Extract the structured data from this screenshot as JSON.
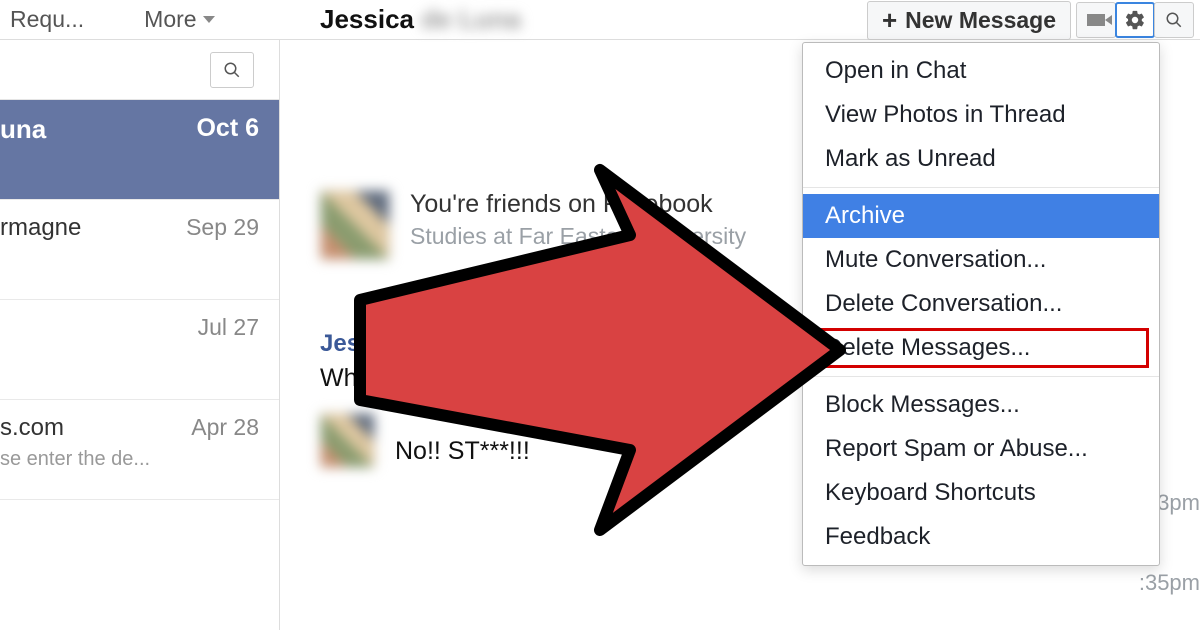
{
  "header": {
    "requests_label": "Requ...",
    "more_label": "More",
    "thread_name": "Jessica",
    "thread_name_blurred": "de Luna",
    "new_message_label": "New Message"
  },
  "sidebar": {
    "items": [
      {
        "name": "una",
        "date": "Oct 6",
        "preview": ""
      },
      {
        "name": "rmagne",
        "date": "Sep 29",
        "preview": ""
      },
      {
        "name": "",
        "date": "Jul 27",
        "preview": ""
      },
      {
        "name": "s.com",
        "date": "Apr 28",
        "preview": "se enter the de..."
      }
    ]
  },
  "main": {
    "friend_line": "You're friends on Facebook",
    "friend_sub": "Studies at Far Eastern University",
    "msg1_name": "Jessica",
    "msg1_body": "Who are you? Please stop stealing and p",
    "msg2_body": "No!! ST***!!!",
    "time1": ":33pm",
    "time2": ":35pm"
  },
  "dropdown": {
    "items": [
      {
        "label": "Open in Chat",
        "type": "normal"
      },
      {
        "label": "View Photos in Thread",
        "type": "normal"
      },
      {
        "label": "Mark as Unread",
        "type": "normal"
      },
      {
        "label": "Archive",
        "type": "highlighted"
      },
      {
        "label": "Mute Conversation...",
        "type": "normal"
      },
      {
        "label": "Delete Conversation...",
        "type": "normal"
      },
      {
        "label": "Delete Messages...",
        "type": "boxed"
      },
      {
        "label": "Block Messages...",
        "type": "normal"
      },
      {
        "label": "Report Spam or Abuse...",
        "type": "normal"
      },
      {
        "label": "Keyboard Shortcuts",
        "type": "normal"
      },
      {
        "label": "Feedback",
        "type": "normal"
      }
    ]
  },
  "colors": {
    "facebook_blue": "#3b5998",
    "selected_bg": "#6576a3",
    "highlight_blue": "#4080e4",
    "callout_red": "#d30000",
    "arrow_red": "#d94242"
  }
}
